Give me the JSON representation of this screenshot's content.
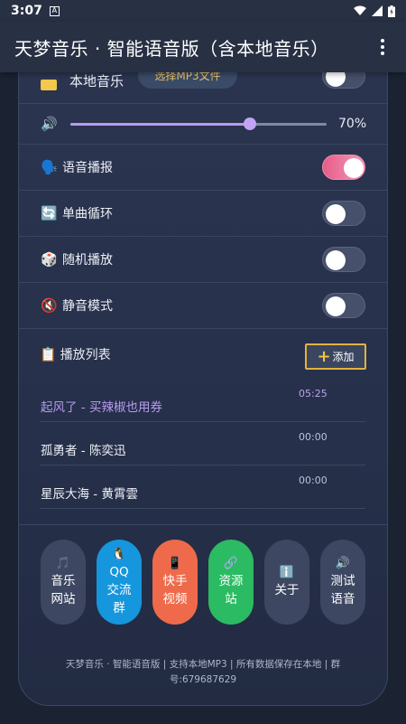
{
  "status_bar": {
    "time": "3:07",
    "a_icon": "A"
  },
  "app_bar": {
    "title": "天梦音乐 · 智能语音版（含本地音乐）"
  },
  "local_music": {
    "icon": "folder-icon",
    "label": "本地音乐",
    "button": "选择MP3文件",
    "toggle_on": false
  },
  "volume": {
    "icon": "speaker-icon",
    "value": 70,
    "label": "70%"
  },
  "settings": [
    {
      "emoji": "🗣️",
      "label": "语音播报",
      "on": true
    },
    {
      "emoji": "🔄",
      "label": "单曲循环",
      "on": false
    },
    {
      "emoji": "🎲",
      "label": "随机播放",
      "on": false
    },
    {
      "emoji": "🔇",
      "label": "静音模式",
      "on": false
    }
  ],
  "playlist": {
    "emoji": "📋",
    "title": "播放列表",
    "add_label": "添加",
    "songs": [
      {
        "name": "起风了 - 买辣椒也用券",
        "duration": "05:25",
        "active": true
      },
      {
        "name": "孤勇者 - 陈奕迅",
        "duration": "00:00",
        "active": false
      },
      {
        "name": "星辰大海 - 黄霄雲",
        "duration": "00:00",
        "active": false
      }
    ]
  },
  "actions": [
    {
      "icon": "🎵",
      "lines": [
        "音乐",
        "网站"
      ],
      "style": ""
    },
    {
      "icon": "🐧",
      "lines": [
        "QQ",
        "交流",
        "群"
      ],
      "style": "qq"
    },
    {
      "icon": "📱",
      "lines": [
        "快手",
        "视频"
      ],
      "style": "ks"
    },
    {
      "icon": "🔗",
      "lines": [
        "资源",
        "站"
      ],
      "style": "res"
    },
    {
      "icon": "ℹ️",
      "lines": [
        "关于"
      ],
      "style": ""
    },
    {
      "icon": "🔊",
      "lines": [
        "测试",
        "语音"
      ],
      "style": ""
    }
  ],
  "footer": {
    "text": "天梦音乐 · 智能语音版 | 支持本地MP3 | 所有数据保存在本地 | 群号:679687629"
  },
  "colors": {
    "accent": "#b69aef",
    "toggle_on": "#e75d8a",
    "add_border": "#e2b33e"
  }
}
